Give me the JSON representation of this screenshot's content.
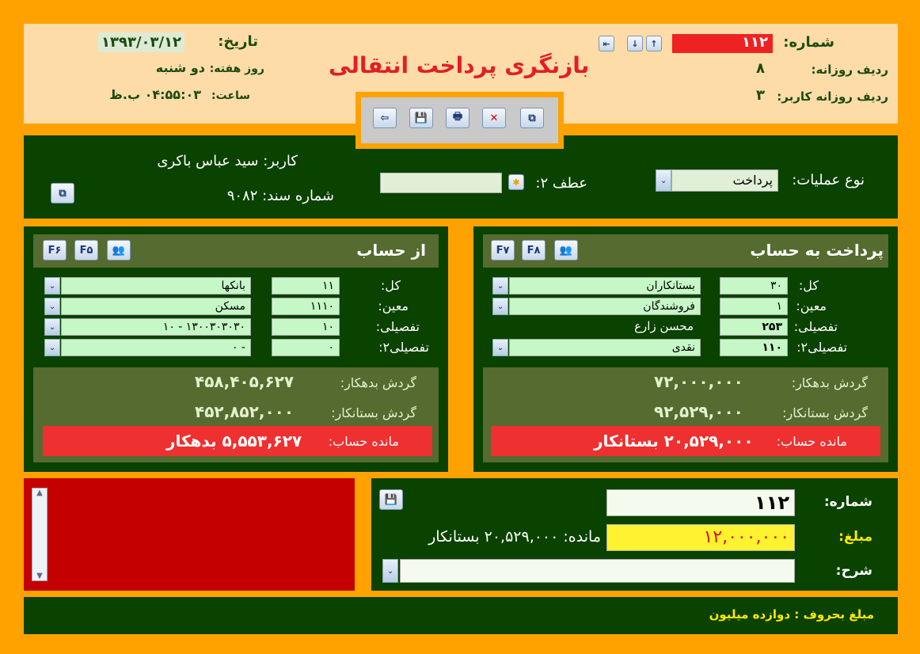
{
  "header": {
    "title": "بازنگری پرداخت انتقالی",
    "date_label": "تاریخ:",
    "date": "۱۳۹۳/۰۳/۱۲",
    "weekday_label": "روز هفته:",
    "weekday": "دو شنبه",
    "time_label": "ساعت:",
    "time": "۰۴:۵۵:۰۳ ب.ظ",
    "number_label": "شماره:",
    "number": "۱۱۲",
    "daily_row_label": "ردیف روزانه:",
    "daily_row": "۸",
    "user_daily_row_label": "ردیف روزانه کاربر:",
    "user_daily_row": "۳",
    "number_color": "#EE2222"
  },
  "toolbar": {
    "icons": [
      "back-arrow-icon",
      "save-icon",
      "print-icon",
      "delete-icon",
      "link-icon"
    ]
  },
  "ops": {
    "op_type_label": "نوع عملیات:",
    "op_type": "پرداخت",
    "ref2_label": "عطف ۲:",
    "ref2": "",
    "user_label": "کاربر:",
    "user": "سید عباس باکری",
    "doc_number_label": "شماره سند:",
    "doc_number": "۹۰۸۲"
  },
  "labels": {
    "kol": "کل:",
    "moein": "معین:",
    "tafsili": "تفصیلی:",
    "tafsili2": "تفصیلی۲:",
    "debit_turnover": "گردش بدهکار:",
    "credit_turnover": "گردش بستانکار:",
    "balance": "مانده حساب:"
  },
  "from_account": {
    "title": "از حساب",
    "keys": [
      "F۶",
      "F۵"
    ],
    "kol_code": "۱۱",
    "kol_name": "بانکها",
    "moein_code": "۱۱۱۰",
    "moein_name": "مسکن",
    "tafsili_code": "۱۰",
    "tafsili_name": "۱۳۰۰۳۰۳۰۳۰ - ۱۰",
    "tafsili2_code": "۰",
    "tafsili2_name": "- ۰",
    "debit": "۴۵۸,۴۰۵,۶۲۷",
    "credit": "۴۵۲,۸۵۲,۰۰۰",
    "balance": "۵,۵۵۳,۶۲۷ بدهکار"
  },
  "to_account": {
    "title": "پرداخت به حساب",
    "keys": [
      "F۷",
      "F۸"
    ],
    "kol_code": "۳۰",
    "kol_name": "بستانکاران",
    "moein_code": "۱",
    "moein_name": "فروشندگان",
    "tafsili_code": "۲۵۳",
    "tafsili_name": "محسن زارع",
    "tafsili2_code": "۱۱۰",
    "tafsili2_name": "نقدی",
    "debit": "۷۲,۰۰۰,۰۰۰",
    "credit": "۹۲,۵۲۹,۰۰۰",
    "balance": "۲۰,۵۲۹,۰۰۰ بستانکار"
  },
  "entry": {
    "number_label": "شماره:",
    "number": "۱۱۲",
    "amount_label": "مبلغ:",
    "amount": "۱۲,۰۰۰,۰۰۰",
    "remaining_label": "مانده:",
    "remaining": "۲۰,۵۲۹,۰۰۰ بستانکار",
    "desc_label": "شرح:",
    "desc": ""
  },
  "footer": {
    "amount_words": "مبلغ بحروف : دوازده میلیون"
  }
}
